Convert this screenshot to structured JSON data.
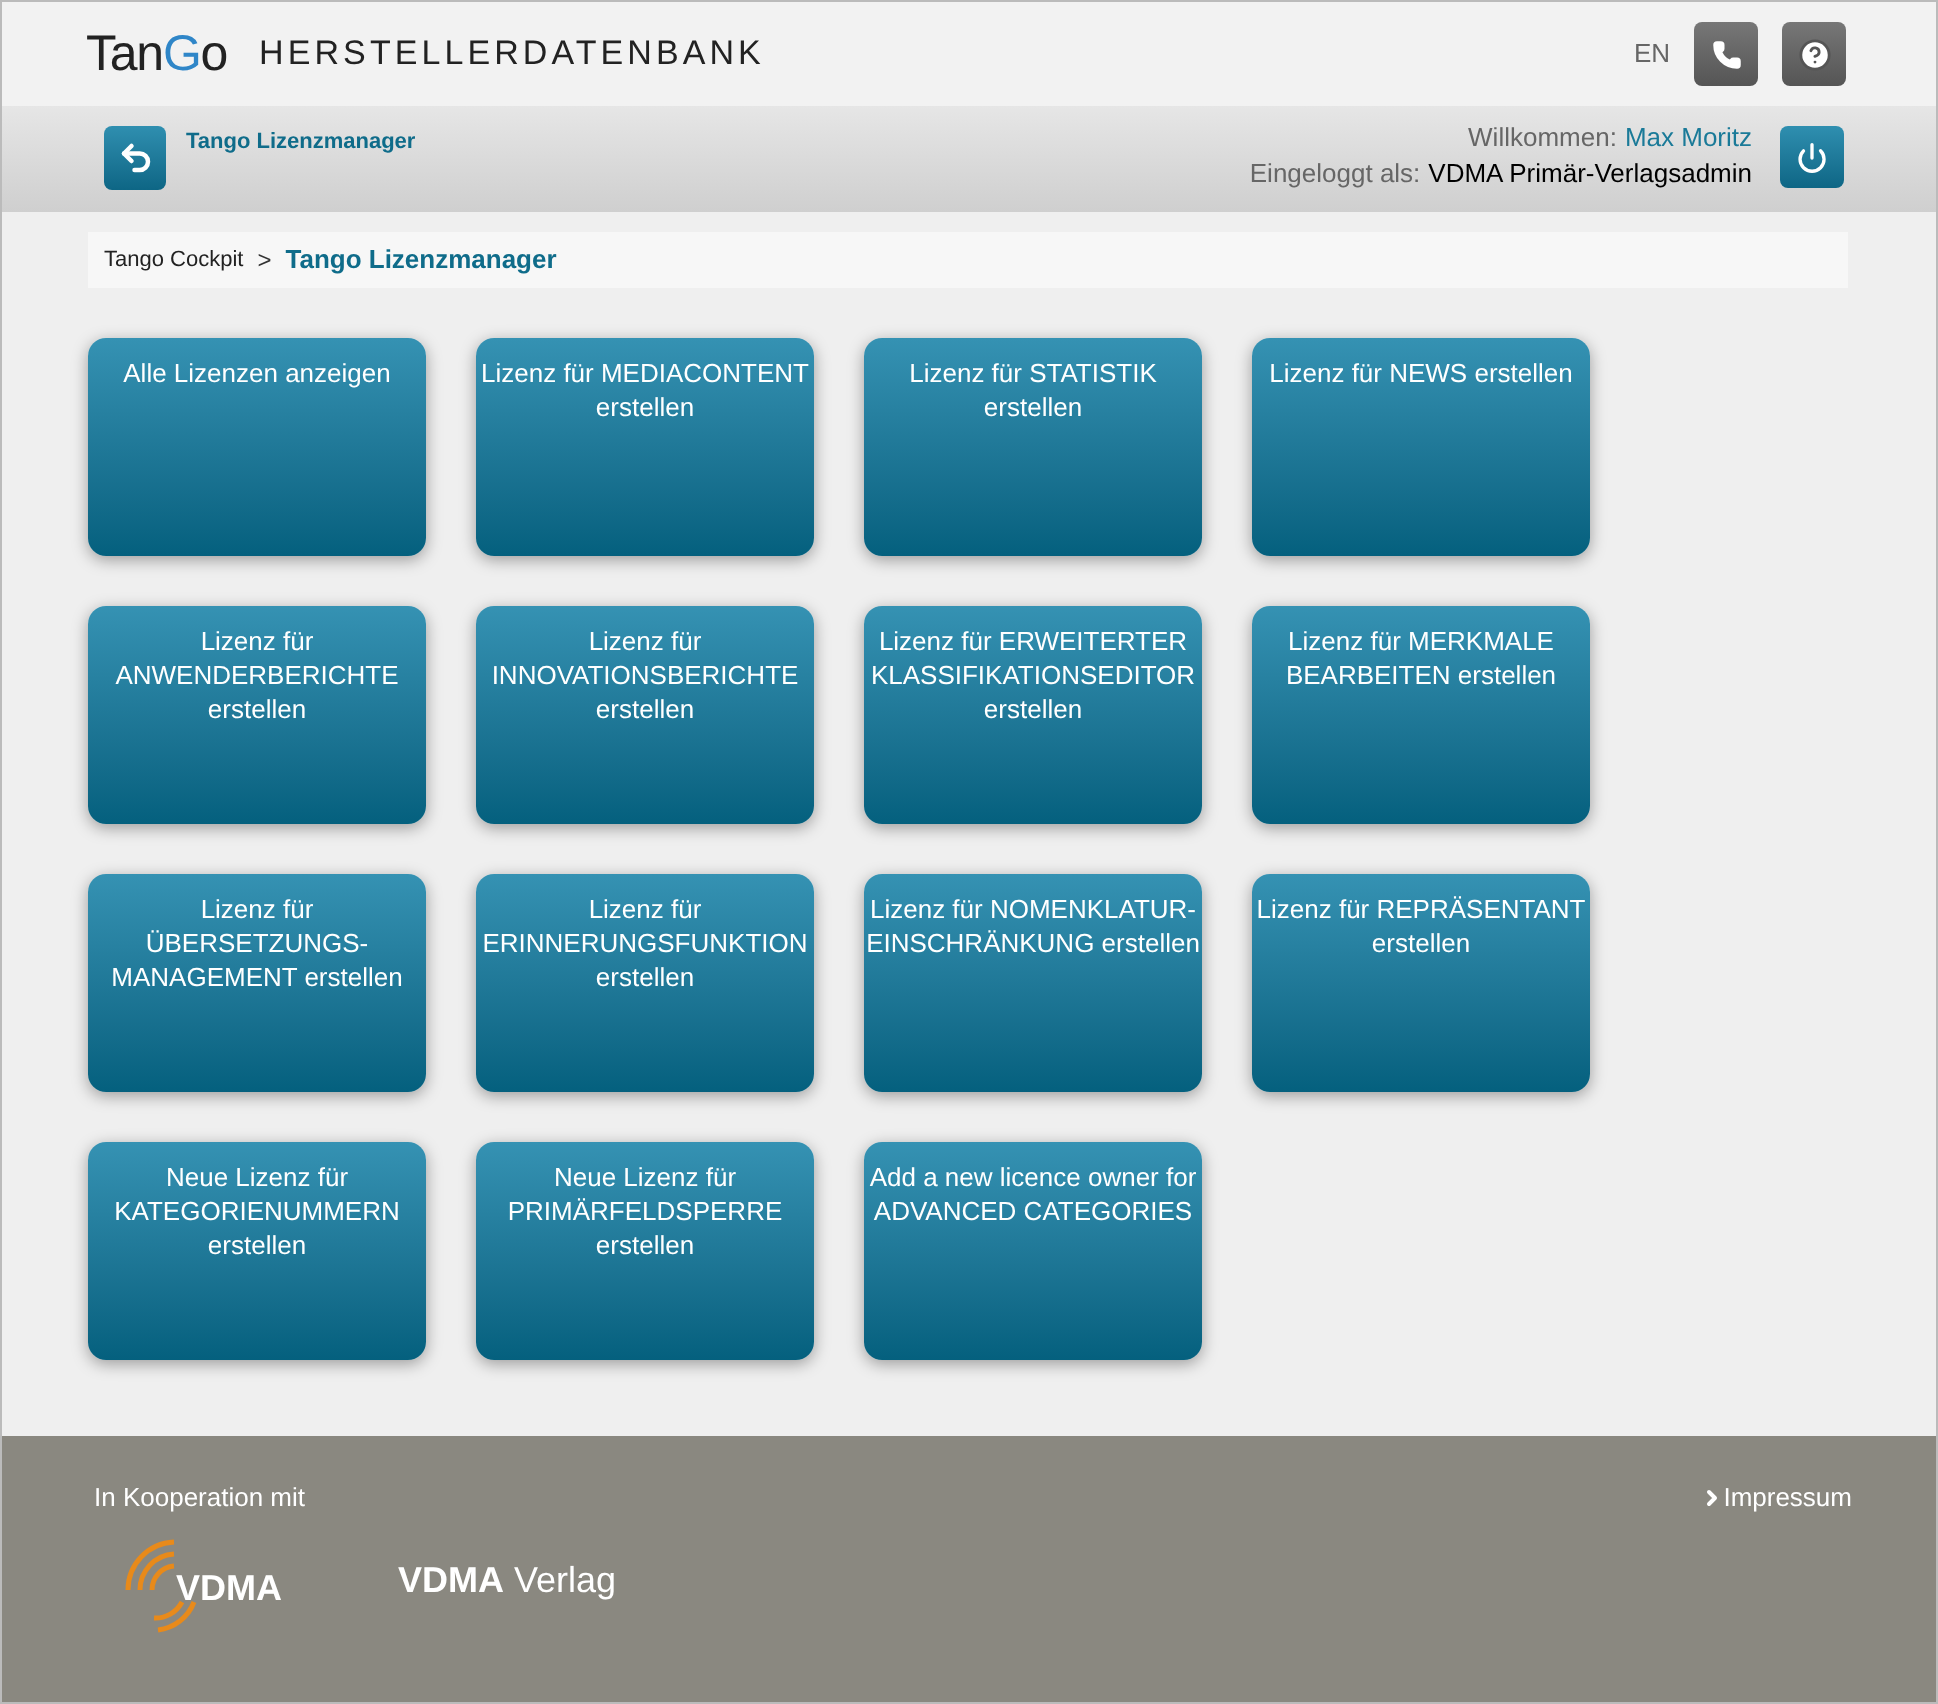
{
  "header": {
    "logo": {
      "prefix": "Tan",
      "accent": "G",
      "suffix": "o"
    },
    "subtitle": "HERSTELLERDATENBANK",
    "language": "EN"
  },
  "subheader": {
    "page_title": "Tango Lizenzmanager",
    "welcome_label": "Willkommen:",
    "user_name": "Max Moritz",
    "login_label": "Eingeloggt als:",
    "role": "VDMA Primär-Verlagsadmin"
  },
  "breadcrumb": [
    {
      "label": "Tango Cockpit",
      "selected": false
    },
    {
      "label": ">",
      "kind": "separator"
    },
    {
      "label": "Tango Lizenzmanager",
      "selected": true
    }
  ],
  "tiles": [
    {
      "label": "Alle Lizenzen anzeigen"
    },
    {
      "label": "Lizenz für MEDIACONTENT erstellen"
    },
    {
      "label": "Lizenz für STATISTIK erstellen"
    },
    {
      "label": "Lizenz für NEWS erstellen"
    },
    {
      "label": "Lizenz für ANWENDERBERICHTE erstellen"
    },
    {
      "label": "Lizenz für INNOVATIONSBERICHTE erstellen"
    },
    {
      "label": "Lizenz für ERWEITERTER KLASSIFIKATIONSEDITOR erstellen"
    },
    {
      "label": "Lizenz für MERKMALE BEARBEITEN erstellen"
    },
    {
      "label": "Lizenz für ÜBERSETZUNGS-MANAGEMENT erstellen"
    },
    {
      "label": "Lizenz für ERINNERUNGSFUNKTION erstellen"
    },
    {
      "label": "Lizenz für NOMENKLATUR-EINSCHRÄNKUNG erstellen"
    },
    {
      "label": "Lizenz für REPRÄSENTANT erstellen"
    },
    {
      "label": "Neue Lizenz für KATEGORIENUMMERN erstellen"
    },
    {
      "label": "Neue Lizenz für PRIMÄRFELDSPERRE erstellen"
    },
    {
      "label": "Add a new licence owner for ADVANCED CATEGORIES"
    }
  ],
  "footer": {
    "cooperation": "In Kooperation mit",
    "partner_logo": "VDMA",
    "publisher_bold": "VDMA",
    "publisher_rest": "Verlag",
    "impressum": "Impressum"
  }
}
